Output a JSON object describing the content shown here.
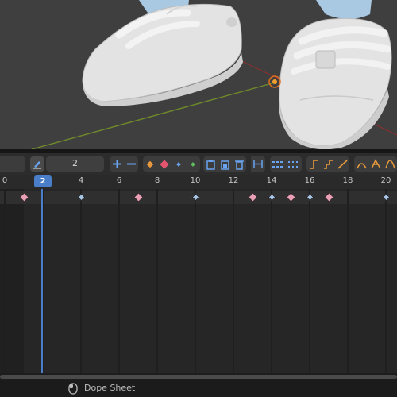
{
  "editor": {
    "type": "Dope Sheet",
    "current_frame": "2",
    "frame_field_value": "2"
  },
  "ruler": {
    "ticks": [
      "0",
      "2",
      "4",
      "6",
      "8",
      "10",
      "12",
      "14",
      "16",
      "18",
      "20"
    ]
  },
  "keyframes": {
    "pink_frames": [
      1,
      7,
      13,
      15,
      17
    ],
    "blue_frames": [
      4,
      10,
      14,
      16,
      20
    ]
  },
  "toolbar_icons": [
    "zoom-in-icon",
    "zoom-out-icon",
    "keyframe-orange-icon",
    "keyframe-red-icon",
    "keyframe-blue-icon",
    "keyframe-green-icon",
    "clipboard-copy-icon",
    "clipboard-paste-icon",
    "delete-icon",
    "snap-icon",
    "markers-icon",
    "markers-flip-icon",
    "interpolation-constant-icon",
    "interpolation-step-icon",
    "interpolation-linear-icon",
    "easing-in-icon",
    "easing-out-icon",
    "easing-inout-icon"
  ],
  "colors": {
    "accent": "#4a7ec9",
    "keyframe_selected": "#eaa0b4",
    "keyframe_normal": "#a9c6e4",
    "toolbar_icon": "#6aa3f0",
    "key_orange": "#e89a3c"
  }
}
